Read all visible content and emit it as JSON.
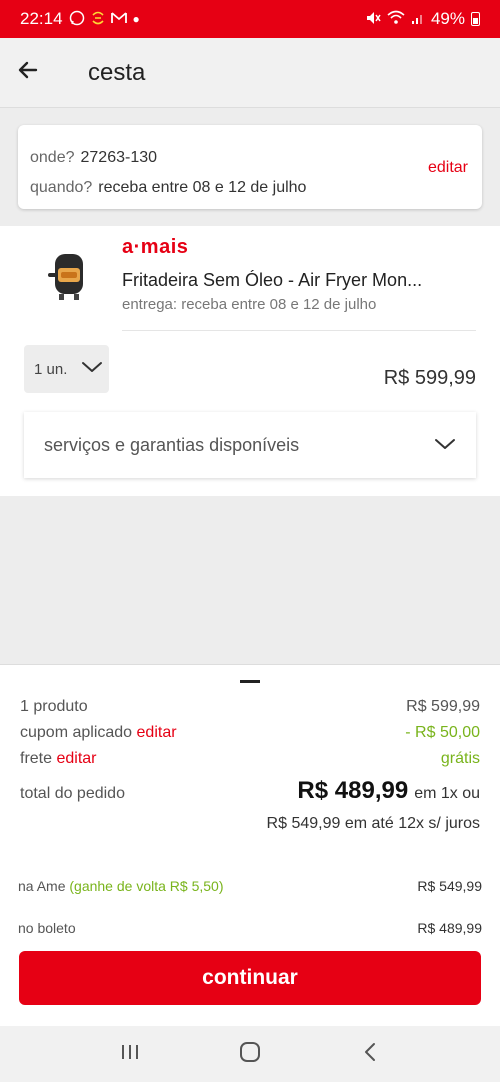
{
  "status_bar": {
    "time": "22:14",
    "battery": "49%"
  },
  "header": {
    "title": "cesta"
  },
  "delivery": {
    "where_label": "onde?",
    "where_value": "27263-130",
    "when_label": "quando?",
    "when_value": "receba entre 08 e 12 de julho",
    "edit_label": "editar"
  },
  "product": {
    "seller": "a·mais",
    "name": "Fritadeira Sem Óleo - Air Fryer Mon...",
    "delivery": "entrega: receba entre 08 e 12 de julho",
    "quantity": "1 un.",
    "price": "R$ 599,99",
    "services_label": "serviços e garantias disponíveis"
  },
  "summary": {
    "products_label": "1 produto",
    "products_value": "R$ 599,99",
    "coupon_label": "cupom aplicado",
    "coupon_edit": "editar",
    "coupon_value": "- R$ 50,00",
    "shipping_label": "frete",
    "shipping_edit": "editar",
    "shipping_value": "grátis",
    "total_label": "total do pedido",
    "total_value": "R$ 489,99",
    "total_suffix": "em 1x ou",
    "installments": "R$ 549,99 em até 12x s/ juros",
    "ame_label": "na Ame",
    "ame_cashback": "(ganhe de volta R$ 5,50)",
    "ame_value": "R$ 549,99",
    "boleto_label": "no boleto",
    "boleto_value": "R$ 489,99",
    "continue_label": "continuar"
  },
  "colors": {
    "brand": "#e60014",
    "green": "#79b41c"
  }
}
